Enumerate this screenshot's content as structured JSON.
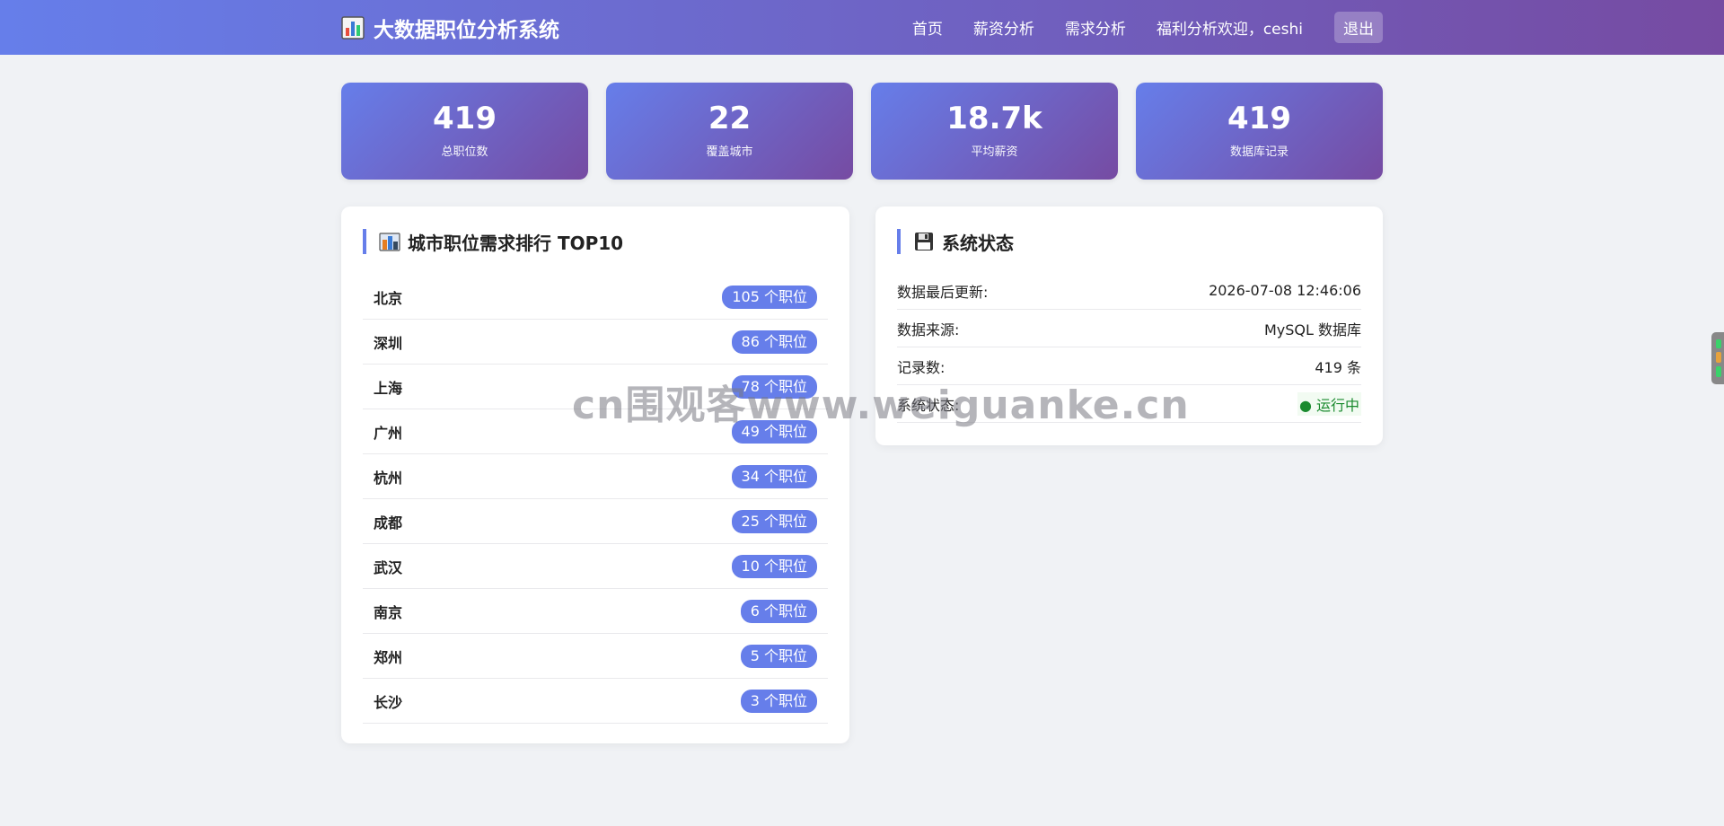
{
  "app": {
    "title": "大数据职位分析系统"
  },
  "nav": {
    "items": [
      "首页",
      "薪资分析",
      "需求分析",
      "福利分析"
    ],
    "welcome": "欢迎，ceshi",
    "logout": "退出"
  },
  "stats": [
    {
      "value": "419",
      "label": "总职位数"
    },
    {
      "value": "22",
      "label": "覆盖城市"
    },
    {
      "value": "18.7k",
      "label": "平均薪资"
    },
    {
      "value": "419",
      "label": "数据库记录"
    }
  ],
  "ranking": {
    "title": "城市职位需求排行 TOP10",
    "rows": [
      {
        "city": "北京",
        "count": "105 个职位"
      },
      {
        "city": "深圳",
        "count": "86 个职位"
      },
      {
        "city": "上海",
        "count": "78 个职位"
      },
      {
        "city": "广州",
        "count": "49 个职位"
      },
      {
        "city": "杭州",
        "count": "34 个职位"
      },
      {
        "city": "成都",
        "count": "25 个职位"
      },
      {
        "city": "武汉",
        "count": "10 个职位"
      },
      {
        "city": "南京",
        "count": "6 个职位"
      },
      {
        "city": "郑州",
        "count": "5 个职位"
      },
      {
        "city": "长沙",
        "count": "3 个职位"
      }
    ]
  },
  "system": {
    "title": "系统状态",
    "rows": [
      {
        "label": "数据最后更新:",
        "value": "2026-07-08 12:46:06"
      },
      {
        "label": "数据来源:",
        "value": "MySQL 数据库"
      },
      {
        "label": "记录数:",
        "value": "419 条"
      },
      {
        "label": "系统状态:",
        "value": "● 运行中"
      }
    ]
  },
  "watermark": "cn围观客www.weiguanke.cn",
  "colors": {
    "accent": "#667eea",
    "accent_end": "#764ba2",
    "ok": "#1a8a2e"
  },
  "icons": {
    "brand": "bar-chart-icon",
    "ranking": "city-buildings-icon",
    "system": "floppy-disk-icon"
  }
}
